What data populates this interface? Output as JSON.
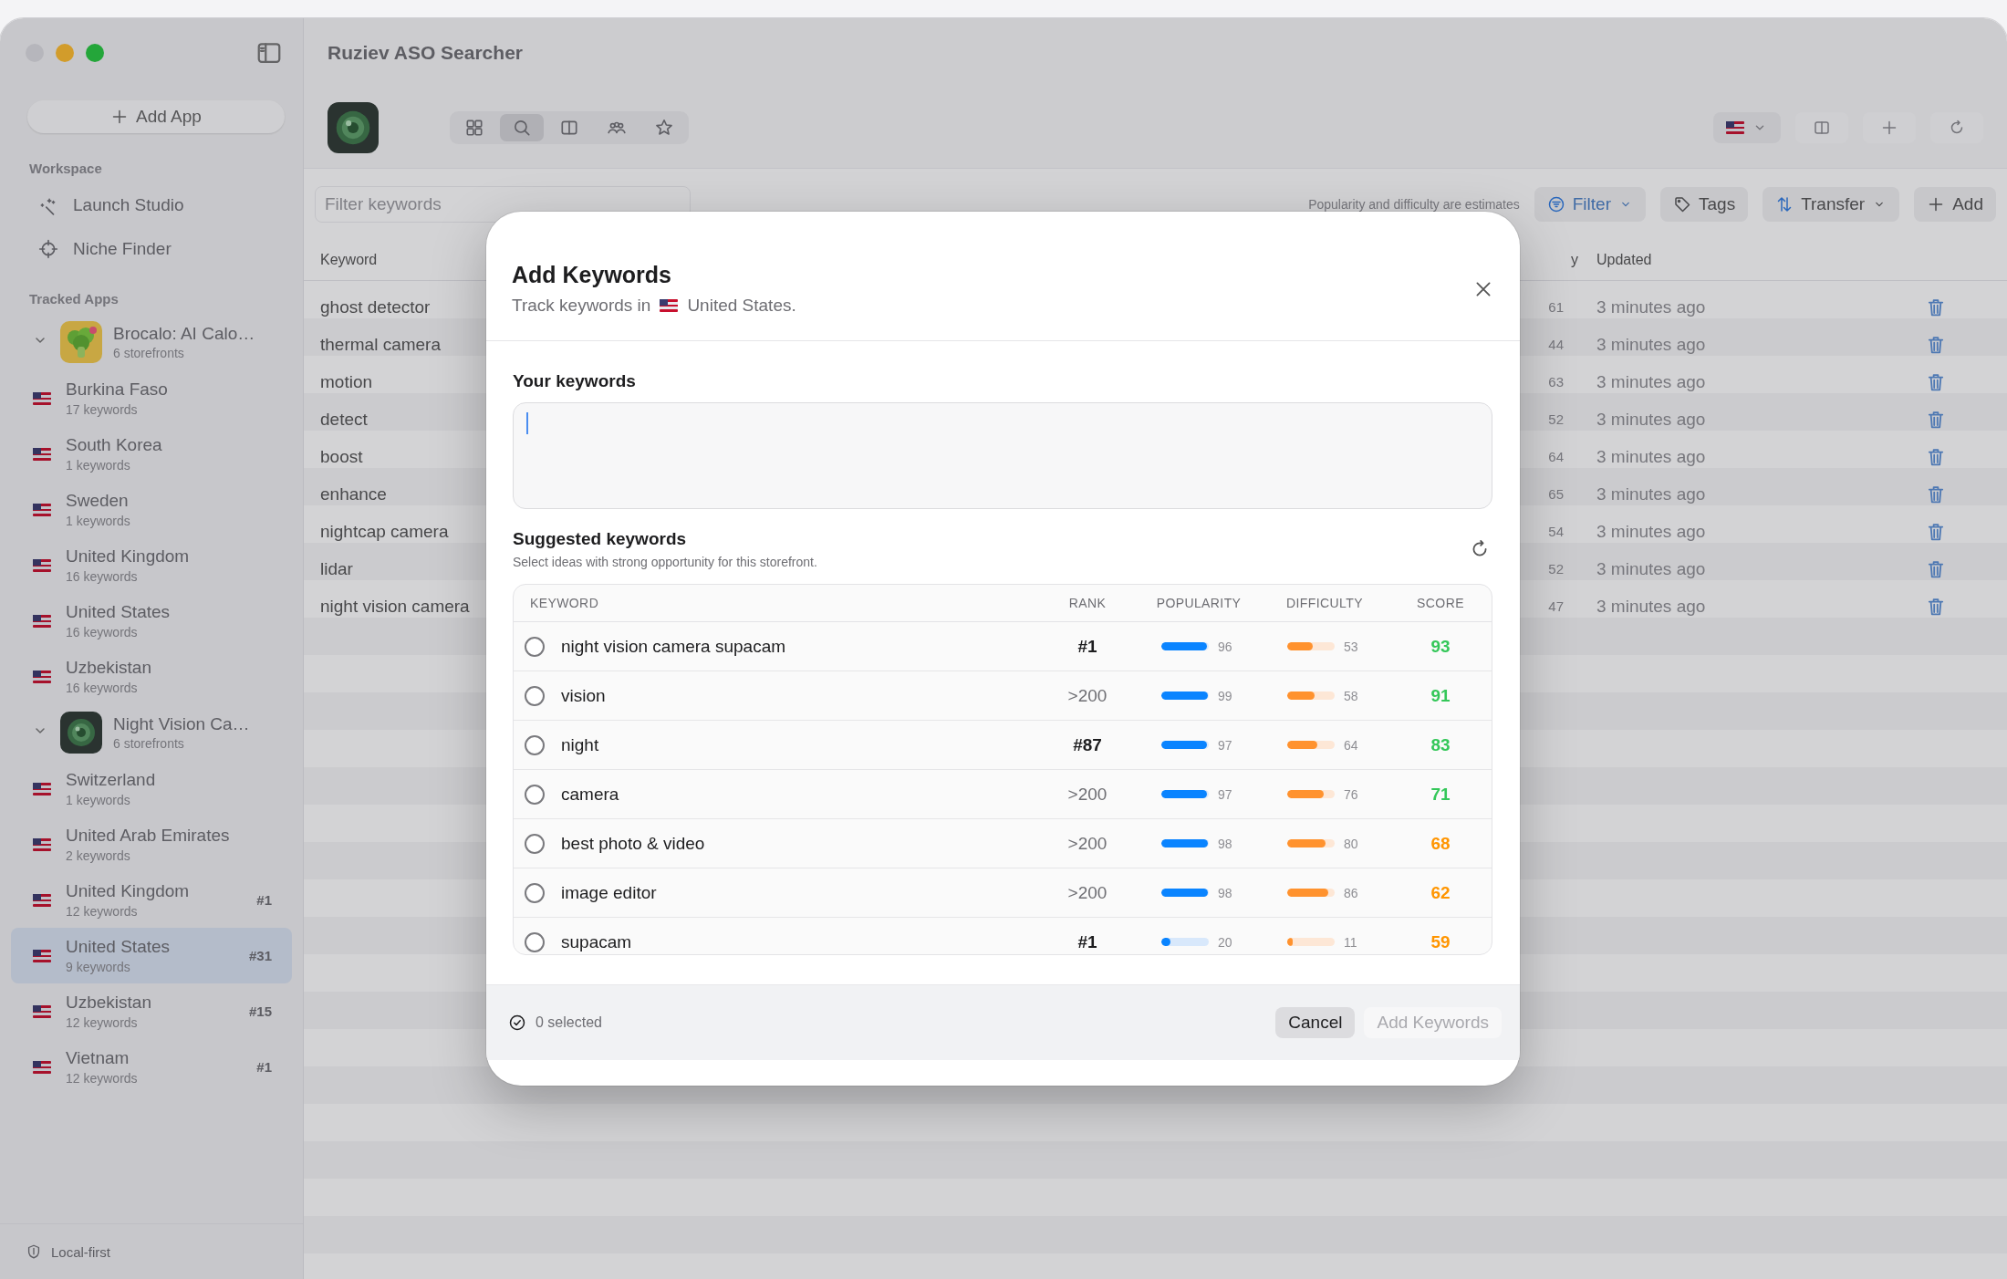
{
  "window": {
    "title": "Ruziev ASO Searcher"
  },
  "sidebar": {
    "add_app": "Add App",
    "workspace_heading": "Workspace",
    "workspace_items": [
      {
        "label": "Launch Studio",
        "kind": "sparkle"
      },
      {
        "label": "Niche Finder",
        "kind": "target"
      }
    ],
    "tracked_heading": "Tracked Apps",
    "apps": [
      {
        "name": "Brocalo: AI Calo…",
        "subtitle": "6 storefronts",
        "kind": "food",
        "expanded": true,
        "children": [
          {
            "name": "Burkina Faso",
            "keywords": "17 keywords",
            "selected": false
          },
          {
            "name": "South Korea",
            "keywords": "1 keywords",
            "selected": false
          },
          {
            "name": "Sweden",
            "keywords": "1 keywords",
            "selected": false
          },
          {
            "name": "United Kingdom",
            "keywords": "16 keywords",
            "selected": false
          },
          {
            "name": "United States",
            "keywords": "16 keywords",
            "selected": false
          },
          {
            "name": "Uzbekistan",
            "keywords": "16 keywords",
            "selected": false
          }
        ]
      },
      {
        "name": "Night Vision Ca…",
        "subtitle": "6 storefronts",
        "kind": "camera",
        "expanded": true,
        "children": [
          {
            "name": "Switzerland",
            "keywords": "1 keywords",
            "selected": false
          },
          {
            "name": "United Arab Emirates",
            "keywords": "2 keywords",
            "selected": false
          },
          {
            "name": "United Kingdom",
            "keywords": "12 keywords",
            "rank": "#1",
            "selected": false
          },
          {
            "name": "United States",
            "keywords": "9 keywords",
            "rank": "#31",
            "selected": true
          },
          {
            "name": "Uzbekistan",
            "keywords": "12 keywords",
            "rank": "#15",
            "selected": false
          },
          {
            "name": "Vietnam",
            "keywords": "12 keywords",
            "rank": "#1",
            "selected": false
          }
        ]
      }
    ],
    "footer": "Local-first"
  },
  "toolbar": {
    "views": [
      {
        "kind": "grid",
        "selected": false
      },
      {
        "kind": "search",
        "selected": true
      },
      {
        "kind": "split",
        "selected": false
      },
      {
        "kind": "people",
        "selected": false
      },
      {
        "kind": "star",
        "selected": false
      }
    ]
  },
  "filter_bar": {
    "search": {
      "placeholder": "Filter keywords"
    },
    "note": "Popularity and difficulty are estimates",
    "buttons": [
      {
        "label": "Filter",
        "kind": "filter",
        "menu": true
      },
      {
        "label": "Tags",
        "kind": "tag",
        "menu": false
      },
      {
        "label": "Transfer",
        "kind": "transfer",
        "menu": true
      },
      {
        "label": "Add",
        "kind": "add",
        "menu": false
      }
    ]
  },
  "table": {
    "columns": [
      "Keyword",
      "y",
      "Updated"
    ],
    "rows": [
      {
        "keyword": "ghost detector",
        "value": "61",
        "updated": "3 minutes ago"
      },
      {
        "keyword": "thermal camera",
        "value": "44",
        "updated": "3 minutes ago"
      },
      {
        "keyword": "motion",
        "value": "63",
        "updated": "3 minutes ago"
      },
      {
        "keyword": "detect",
        "value": "52",
        "updated": "3 minutes ago"
      },
      {
        "keyword": "boost",
        "value": "64",
        "updated": "3 minutes ago"
      },
      {
        "keyword": "enhance",
        "value": "65",
        "updated": "3 minutes ago"
      },
      {
        "keyword": "nightcap camera",
        "value": "54",
        "updated": "3 minutes ago"
      },
      {
        "keyword": "lidar",
        "value": "52",
        "updated": "3 minutes ago"
      },
      {
        "keyword": "night vision camera",
        "value": "47",
        "updated": "3 minutes ago"
      }
    ]
  },
  "dialog": {
    "title": "Add Keywords",
    "subtitle": "Track keywords in",
    "country": "United States.",
    "your_keywords": {
      "label": "Your keywords",
      "focused": true
    },
    "suggested": {
      "title": "Suggested keywords",
      "subtitle": "Select ideas with strong opportunity for this storefront.",
      "columns": [
        "KEYWORD",
        "RANK",
        "POPULARITY",
        "DIFFICULTY",
        "SCORE"
      ],
      "rows": [
        {
          "keyword": "night vision camera supacam",
          "rank": "#1",
          "ranked": true,
          "popularity": {
            "level": 0.96,
            "reading": "96"
          },
          "difficulty": {
            "level": 0.53,
            "reading": "53"
          },
          "score": "93",
          "color": "#34c759",
          "selected": false
        },
        {
          "keyword": "vision",
          "rank": ">200",
          "ranked": false,
          "popularity": {
            "level": 0.99,
            "reading": "99"
          },
          "difficulty": {
            "level": 0.58,
            "reading": "58"
          },
          "score": "91",
          "color": "#34c759",
          "selected": false
        },
        {
          "keyword": "night",
          "rank": "#87",
          "ranked": true,
          "popularity": {
            "level": 0.97,
            "reading": "97"
          },
          "difficulty": {
            "level": 0.64,
            "reading": "64"
          },
          "score": "83",
          "color": "#34c759",
          "selected": false
        },
        {
          "keyword": "camera",
          "rank": ">200",
          "ranked": false,
          "popularity": {
            "level": 0.97,
            "reading": "97"
          },
          "difficulty": {
            "level": 0.76,
            "reading": "76"
          },
          "score": "71",
          "color": "#34c759",
          "selected": false
        },
        {
          "keyword": "best photo & video",
          "rank": ">200",
          "ranked": false,
          "popularity": {
            "level": 0.98,
            "reading": "98"
          },
          "difficulty": {
            "level": 0.8,
            "reading": "80"
          },
          "score": "68",
          "color": "#ff9500",
          "selected": false
        },
        {
          "keyword": "image editor",
          "rank": ">200",
          "ranked": false,
          "popularity": {
            "level": 0.98,
            "reading": "98"
          },
          "difficulty": {
            "level": 0.86,
            "reading": "86"
          },
          "score": "62",
          "color": "#ff9500",
          "selected": false
        },
        {
          "keyword": "supacam",
          "rank": "#1",
          "ranked": true,
          "popularity": {
            "level": 0.2,
            "reading": "20"
          },
          "difficulty": {
            "level": 0.11,
            "reading": "11"
          },
          "score": "59",
          "color": "#ff9500",
          "selected": false
        }
      ]
    },
    "footer": {
      "selected_count": "0 selected",
      "buttons": [
        {
          "label": "Cancel",
          "disabled": false
        },
        {
          "label": "Add Keywords",
          "disabled": true
        }
      ]
    }
  }
}
